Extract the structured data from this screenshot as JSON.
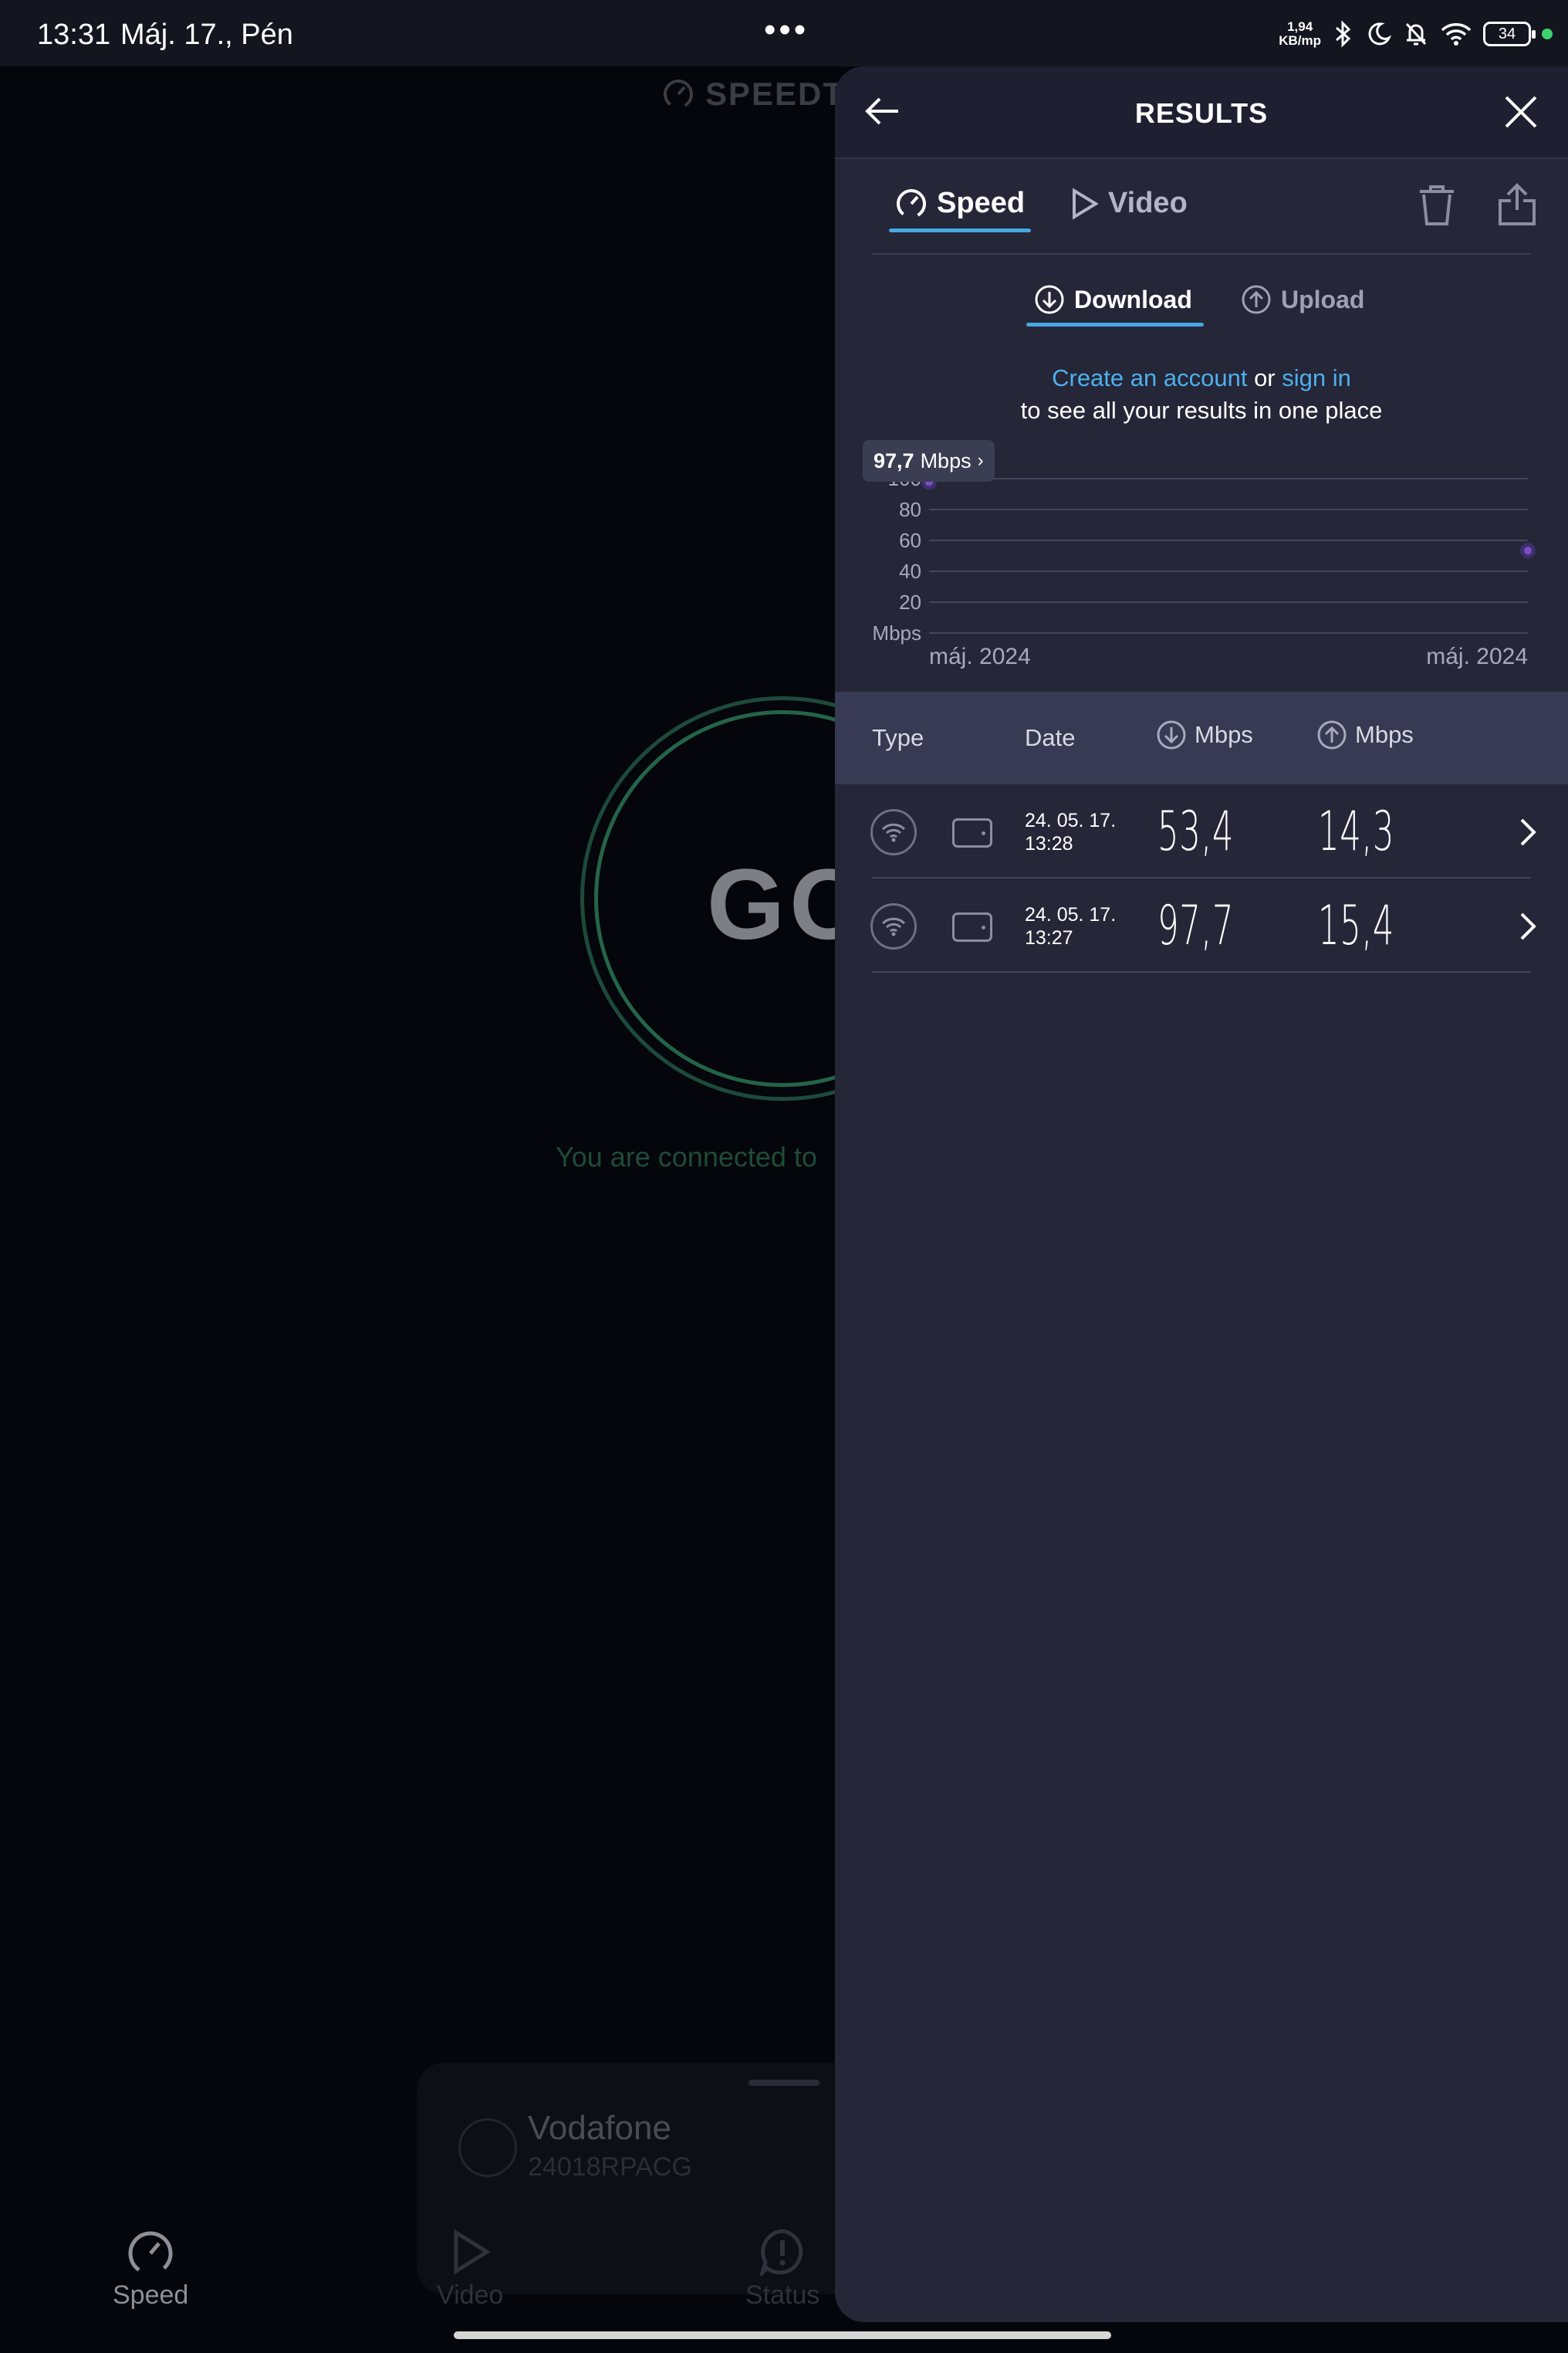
{
  "status_bar": {
    "time": "13:31",
    "date": "Máj. 17., Pén",
    "net_speed_value": "1,94",
    "net_speed_unit": "KB/mp",
    "battery": "34",
    "icons": [
      "bluetooth-icon",
      "moon-icon",
      "bell-off-icon",
      "wifi-icon",
      "battery-icon"
    ]
  },
  "background_app": {
    "logo": "SPEEDT",
    "go_button": "GO",
    "connected_text": "You are connected to",
    "provider_name": "Vodafone",
    "provider_device": "24018RPACG",
    "nav": [
      {
        "label": "Speed",
        "icon": "speedometer-icon"
      },
      {
        "label": "Video",
        "icon": "play-icon"
      },
      {
        "label": "Status",
        "icon": "alert-icon"
      }
    ]
  },
  "panel": {
    "title": "RESULTS",
    "tabs": [
      {
        "label": "Speed",
        "icon": "speedometer-icon",
        "active": true
      },
      {
        "label": "Video",
        "icon": "play-icon",
        "active": false
      }
    ],
    "sub_tabs": [
      {
        "label": "Download",
        "icon": "download-icon",
        "active": true
      },
      {
        "label": "Upload",
        "icon": "upload-icon",
        "active": false
      }
    ],
    "account_prompt": {
      "link1": "Create an account",
      "middle": "or",
      "link2": "sign in",
      "line2": "to see all your results in one place"
    },
    "tooltip": {
      "value": "97,7",
      "unit": "Mbps"
    },
    "table": {
      "headers": {
        "type": "Type",
        "date": "Date",
        "download": "Mbps",
        "upload": "Mbps"
      },
      "rows": [
        {
          "date": "24. 05. 17.",
          "time": "13:28",
          "download": "53,4",
          "upload": "14,3"
        },
        {
          "date": "24. 05. 17.",
          "time": "13:27",
          "download": "97,7",
          "upload": "15,4"
        }
      ]
    },
    "colors": {
      "accent": "#47a7e3",
      "link": "#4db0ec",
      "point": "#7a4fc4",
      "panel": "#252638"
    }
  },
  "chart_data": {
    "type": "line",
    "ylabel": "Mbps",
    "y_ticks": [
      "100",
      "80",
      "60",
      "40",
      "20"
    ],
    "ylim": [
      0,
      100
    ],
    "x_tick_labels": [
      "máj. 2024",
      "máj. 2024"
    ],
    "series": [
      {
        "values": [
          97.7,
          53.4
        ]
      }
    ],
    "grid": true
  }
}
